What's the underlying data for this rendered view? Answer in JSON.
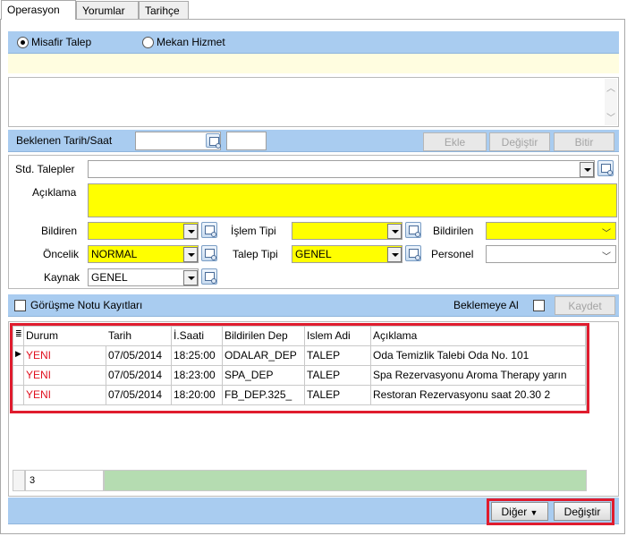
{
  "tabs": [
    "Operasyon",
    "Yorumlar",
    "Tarihçe"
  ],
  "request_type": {
    "options": [
      "Misafir Talep",
      "Mekan Hizmet"
    ],
    "selected": "Misafir Talep"
  },
  "expected": {
    "label": "Beklenen Tarih/Saat",
    "date_value": "",
    "time_value": "",
    "buttons": [
      "Ekle",
      "Değiştir",
      "Bitir"
    ]
  },
  "form": {
    "std_talepler_label": "Std. Talepler",
    "std_talepler_value": "",
    "aciklama_label": "Açıklama",
    "aciklama_value": "",
    "bildiren_label": "Bildiren",
    "bildiren_value": "",
    "islem_tipi_label": "İşlem Tipi",
    "islem_tipi_value": "",
    "bildirilen_label": "Bildirilen",
    "bildirilen_value": "",
    "oncelik_label": "Öncelik",
    "oncelik_value": "NORMAL",
    "talep_tipi_label": "Talep Tipi",
    "talep_tipi_value": "GENEL",
    "personel_label": "Personel",
    "personel_value": "",
    "kaynak_label": "Kaynak",
    "kaynak_value": "GENEL"
  },
  "notes_bar": {
    "gorusme_label": "Görüşme Notu Kayıtları",
    "beklemeye_label": "Beklemeye Al",
    "kaydet_label": "Kaydet"
  },
  "grid": {
    "columns": [
      "Durum",
      "Tarih",
      "İ.Saati",
      "Bildirilen Dep",
      "Islem Adi",
      "Açıklama"
    ],
    "rows": [
      [
        "YENI",
        "07/05/2014",
        "18:25:00",
        "ODALAR_DEP",
        "TALEP",
        "Oda Temizlik Talebi Oda No. 101"
      ],
      [
        "YENI",
        "07/05/2014",
        "18:23:00",
        "SPA_DEP",
        "TALEP",
        "Spa Rezervasyonu Aroma Therapy yarın"
      ],
      [
        "YENI",
        "07/05/2014",
        "18:20:00",
        "FB_DEP.325_",
        "TALEP",
        "Restoran Rezervasyonu saat 20.30 2"
      ]
    ],
    "row_count": "3"
  },
  "bottom_buttons": {
    "diger": "Diğer",
    "degistir": "Değiştir"
  },
  "colors": {
    "blue_bar": "#a9ccf0",
    "required_yellow": "#ffff00",
    "status_red": "#e0101e",
    "highlight_red": "#e01c2e"
  }
}
